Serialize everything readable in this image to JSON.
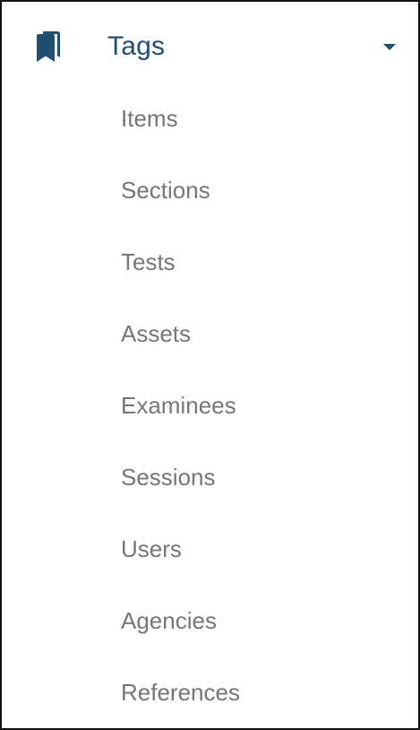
{
  "menu": {
    "title": "Tags",
    "icon": "bookmarks-icon",
    "expand_icon": "caret-down-icon",
    "accent_color": "#1f4e70",
    "item_color": "#767676",
    "items": [
      {
        "label": "Items",
        "name": "submenu-item-items"
      },
      {
        "label": "Sections",
        "name": "submenu-item-sections"
      },
      {
        "label": "Tests",
        "name": "submenu-item-tests"
      },
      {
        "label": "Assets",
        "name": "submenu-item-assets"
      },
      {
        "label": "Examinees",
        "name": "submenu-item-examinees"
      },
      {
        "label": "Sessions",
        "name": "submenu-item-sessions"
      },
      {
        "label": "Users",
        "name": "submenu-item-users"
      },
      {
        "label": "Agencies",
        "name": "submenu-item-agencies"
      },
      {
        "label": "References",
        "name": "submenu-item-references"
      }
    ]
  }
}
